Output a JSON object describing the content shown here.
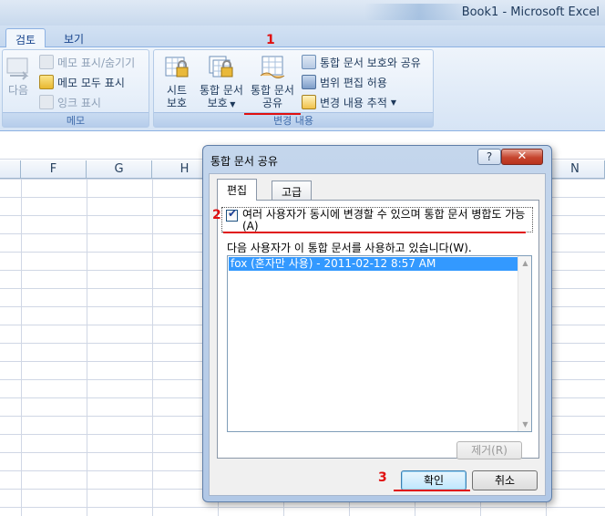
{
  "window": {
    "title": "Book1 - Microsoft Excel"
  },
  "ribbon": {
    "tabs": [
      {
        "label": "검토"
      },
      {
        "label": "보기"
      }
    ],
    "memo_group": {
      "label": "메모",
      "next": "다음",
      "show_hide": "메모 표시/숨기기",
      "show_all": "메모 모두 표시",
      "show_ink": "잉크 표시"
    },
    "changes_group": {
      "label": "변경 내용",
      "protect_sheet": [
        "시트",
        "보호"
      ],
      "protect_workbook": [
        "통합 문서",
        "보호"
      ],
      "share_workbook": [
        "통합 문서",
        "공유"
      ],
      "protect_share": "통합 문서 보호와 공유",
      "allow_ranges": "범위 편집 허용",
      "track_changes": "변경 내용 추적"
    }
  },
  "sheet": {
    "columns": [
      "F",
      "G",
      "H",
      "N"
    ]
  },
  "dialog": {
    "title": "통합 문서 공유",
    "help": "?",
    "close": "✕",
    "tabs": [
      "편집",
      "고급"
    ],
    "allow_changes_label": "여러 사용자가 동시에 변경할 수 있으며 통합 문서 병합도 가능(A)",
    "allow_changes_checked": true,
    "users_label": "다음 사용자가 이 통합 문서를 사용하고 있습니다(W).",
    "users": [
      "fox (혼자만 사용) - 2011-02-12 8:57 AM"
    ],
    "remove_button": "제거(R)",
    "ok_button": "확인",
    "cancel_button": "취소"
  },
  "annotations": [
    "1",
    "2",
    "3"
  ],
  "colors": {
    "annotation": "#e01010",
    "selection": "#3399ff"
  }
}
